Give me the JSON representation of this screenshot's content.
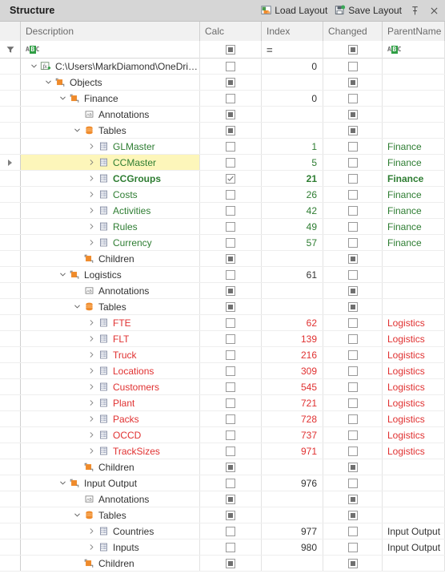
{
  "header": {
    "title": "Structure",
    "load_layout_label": "Load Layout",
    "save_layout_label": "Save Layout",
    "load_layout_icon": "load-layout-icon",
    "save_layout_icon": "save-layout-icon",
    "pin_icon": "pin-icon",
    "close_icon": "close-icon"
  },
  "colors": {
    "green": "#2e7d32",
    "red": "#e03131",
    "dark": "#333333",
    "highlight": "#fdf6ba",
    "accent_orange": "#ef8b2c",
    "panel_header_bg": "#d6d6d6"
  },
  "columns": [
    {
      "key": "gutter",
      "label": ""
    },
    {
      "key": "description",
      "label": "Description"
    },
    {
      "key": "calc",
      "label": "Calc"
    },
    {
      "key": "index",
      "label": "Index"
    },
    {
      "key": "changed",
      "label": "Changed"
    },
    {
      "key": "parentname",
      "label": "ParentName"
    }
  ],
  "filter_row": {
    "gutter_icon": "filter-funnel-icon",
    "description_filter": "ABC",
    "calc_filter_state": "indeterminate",
    "index_filter": "=",
    "changed_filter_state": "indeterminate",
    "parentname_filter": "ABC"
  },
  "rows": [
    {
      "indent": 0,
      "expander": "expanded",
      "icon": "formula-add-icon",
      "label": "C:\\Users\\MarkDiamond\\OneDrive - ...",
      "color": "dark",
      "bold": false,
      "highlight": false,
      "pointer": false,
      "calc": "off",
      "index": "0",
      "changed": "off",
      "parent": ""
    },
    {
      "indent": 1,
      "expander": "expanded",
      "icon": "folder-icon",
      "label": "Objects",
      "color": "dark",
      "bold": false,
      "highlight": false,
      "pointer": false,
      "calc": "indeterminate",
      "index": "",
      "changed": "indeterminate",
      "parent": ""
    },
    {
      "indent": 2,
      "expander": "expanded",
      "icon": "folder-icon",
      "label": "Finance",
      "color": "dark",
      "bold": false,
      "highlight": false,
      "pointer": false,
      "calc": "off",
      "index": "0",
      "changed": "off",
      "parent": ""
    },
    {
      "indent": 3,
      "expander": "none",
      "icon": "annotation-ab-icon",
      "label": "Annotations",
      "color": "dark",
      "bold": false,
      "highlight": false,
      "pointer": false,
      "calc": "indeterminate",
      "index": "",
      "changed": "indeterminate",
      "parent": ""
    },
    {
      "indent": 3,
      "expander": "expanded",
      "icon": "tables-stack-icon",
      "label": "Tables",
      "color": "dark",
      "bold": false,
      "highlight": false,
      "pointer": false,
      "calc": "indeterminate",
      "index": "",
      "changed": "indeterminate",
      "parent": ""
    },
    {
      "indent": 4,
      "expander": "collapsed",
      "icon": "table-icon",
      "label": "GLMaster",
      "color": "green",
      "bold": false,
      "highlight": false,
      "pointer": false,
      "calc": "off",
      "index": "1",
      "changed": "off",
      "parent": "Finance"
    },
    {
      "indent": 4,
      "expander": "collapsed",
      "icon": "table-icon",
      "label": "CCMaster",
      "color": "green",
      "bold": false,
      "highlight": true,
      "pointer": true,
      "calc": "off",
      "index": "5",
      "changed": "off",
      "parent": "Finance"
    },
    {
      "indent": 4,
      "expander": "collapsed",
      "icon": "table-icon",
      "label": "CCGroups",
      "color": "green",
      "bold": true,
      "highlight": false,
      "pointer": false,
      "calc": "checked",
      "index": "21",
      "changed": "off",
      "parent": "Finance"
    },
    {
      "indent": 4,
      "expander": "collapsed",
      "icon": "table-icon",
      "label": "Costs",
      "color": "green",
      "bold": false,
      "highlight": false,
      "pointer": false,
      "calc": "off",
      "index": "26",
      "changed": "off",
      "parent": "Finance"
    },
    {
      "indent": 4,
      "expander": "collapsed",
      "icon": "table-icon",
      "label": "Activities",
      "color": "green",
      "bold": false,
      "highlight": false,
      "pointer": false,
      "calc": "off",
      "index": "42",
      "changed": "off",
      "parent": "Finance"
    },
    {
      "indent": 4,
      "expander": "collapsed",
      "icon": "table-icon",
      "label": "Rules",
      "color": "green",
      "bold": false,
      "highlight": false,
      "pointer": false,
      "calc": "off",
      "index": "49",
      "changed": "off",
      "parent": "Finance"
    },
    {
      "indent": 4,
      "expander": "collapsed",
      "icon": "table-icon",
      "label": "Currency",
      "color": "green",
      "bold": false,
      "highlight": false,
      "pointer": false,
      "calc": "off",
      "index": "57",
      "changed": "off",
      "parent": "Finance"
    },
    {
      "indent": 3,
      "expander": "none",
      "icon": "children-folder-icon",
      "label": "Children",
      "color": "dark",
      "bold": false,
      "highlight": false,
      "pointer": false,
      "calc": "indeterminate",
      "index": "",
      "changed": "indeterminate",
      "parent": ""
    },
    {
      "indent": 2,
      "expander": "expanded",
      "icon": "folder-icon",
      "label": "Logistics",
      "color": "dark",
      "bold": false,
      "highlight": false,
      "pointer": false,
      "calc": "off",
      "index": "61",
      "changed": "off",
      "parent": ""
    },
    {
      "indent": 3,
      "expander": "none",
      "icon": "annotation-ab-icon",
      "label": "Annotations",
      "color": "dark",
      "bold": false,
      "highlight": false,
      "pointer": false,
      "calc": "indeterminate",
      "index": "",
      "changed": "indeterminate",
      "parent": ""
    },
    {
      "indent": 3,
      "expander": "expanded",
      "icon": "tables-stack-icon",
      "label": "Tables",
      "color": "dark",
      "bold": false,
      "highlight": false,
      "pointer": false,
      "calc": "indeterminate",
      "index": "",
      "changed": "indeterminate",
      "parent": ""
    },
    {
      "indent": 4,
      "expander": "collapsed",
      "icon": "table-icon",
      "label": "FTE",
      "color": "red",
      "bold": false,
      "highlight": false,
      "pointer": false,
      "calc": "off",
      "index": "62",
      "changed": "off",
      "parent": "Logistics"
    },
    {
      "indent": 4,
      "expander": "collapsed",
      "icon": "table-icon",
      "label": "FLT",
      "color": "red",
      "bold": false,
      "highlight": false,
      "pointer": false,
      "calc": "off",
      "index": "139",
      "changed": "off",
      "parent": "Logistics"
    },
    {
      "indent": 4,
      "expander": "collapsed",
      "icon": "table-icon",
      "label": "Truck",
      "color": "red",
      "bold": false,
      "highlight": false,
      "pointer": false,
      "calc": "off",
      "index": "216",
      "changed": "off",
      "parent": "Logistics"
    },
    {
      "indent": 4,
      "expander": "collapsed",
      "icon": "table-icon",
      "label": "Locations",
      "color": "red",
      "bold": false,
      "highlight": false,
      "pointer": false,
      "calc": "off",
      "index": "309",
      "changed": "off",
      "parent": "Logistics"
    },
    {
      "indent": 4,
      "expander": "collapsed",
      "icon": "table-icon",
      "label": "Customers",
      "color": "red",
      "bold": false,
      "highlight": false,
      "pointer": false,
      "calc": "off",
      "index": "545",
      "changed": "off",
      "parent": "Logistics"
    },
    {
      "indent": 4,
      "expander": "collapsed",
      "icon": "table-icon",
      "label": "Plant",
      "color": "red",
      "bold": false,
      "highlight": false,
      "pointer": false,
      "calc": "off",
      "index": "721",
      "changed": "off",
      "parent": "Logistics"
    },
    {
      "indent": 4,
      "expander": "collapsed",
      "icon": "table-icon",
      "label": "Packs",
      "color": "red",
      "bold": false,
      "highlight": false,
      "pointer": false,
      "calc": "off",
      "index": "728",
      "changed": "off",
      "parent": "Logistics"
    },
    {
      "indent": 4,
      "expander": "collapsed",
      "icon": "table-icon",
      "label": "OCCD",
      "color": "red",
      "bold": false,
      "highlight": false,
      "pointer": false,
      "calc": "off",
      "index": "737",
      "changed": "off",
      "parent": "Logistics"
    },
    {
      "indent": 4,
      "expander": "collapsed",
      "icon": "table-icon",
      "label": "TrackSizes",
      "color": "red",
      "bold": false,
      "highlight": false,
      "pointer": false,
      "calc": "off",
      "index": "971",
      "changed": "off",
      "parent": "Logistics"
    },
    {
      "indent": 3,
      "expander": "none",
      "icon": "children-folder-icon",
      "label": "Children",
      "color": "dark",
      "bold": false,
      "highlight": false,
      "pointer": false,
      "calc": "indeterminate",
      "index": "",
      "changed": "indeterminate",
      "parent": ""
    },
    {
      "indent": 2,
      "expander": "expanded",
      "icon": "folder-icon",
      "label": "Input Output",
      "color": "dark",
      "bold": false,
      "highlight": false,
      "pointer": false,
      "calc": "off",
      "index": "976",
      "changed": "off",
      "parent": ""
    },
    {
      "indent": 3,
      "expander": "none",
      "icon": "annotation-ab-icon",
      "label": "Annotations",
      "color": "dark",
      "bold": false,
      "highlight": false,
      "pointer": false,
      "calc": "indeterminate",
      "index": "",
      "changed": "indeterminate",
      "parent": ""
    },
    {
      "indent": 3,
      "expander": "expanded",
      "icon": "tables-stack-icon",
      "label": "Tables",
      "color": "dark",
      "bold": false,
      "highlight": false,
      "pointer": false,
      "calc": "indeterminate",
      "index": "",
      "changed": "indeterminate",
      "parent": ""
    },
    {
      "indent": 4,
      "expander": "collapsed",
      "icon": "table-icon",
      "label": "Countries",
      "color": "dark",
      "bold": false,
      "highlight": false,
      "pointer": false,
      "calc": "off",
      "index": "977",
      "changed": "off",
      "parent": "Input Output"
    },
    {
      "indent": 4,
      "expander": "collapsed",
      "icon": "table-icon",
      "label": "Inputs",
      "color": "dark",
      "bold": false,
      "highlight": false,
      "pointer": false,
      "calc": "off",
      "index": "980",
      "changed": "off",
      "parent": "Input Output"
    },
    {
      "indent": 3,
      "expander": "none",
      "icon": "children-folder-icon",
      "label": "Children",
      "color": "dark",
      "bold": false,
      "highlight": false,
      "pointer": false,
      "calc": "indeterminate",
      "index": "",
      "changed": "indeterminate",
      "parent": ""
    }
  ]
}
